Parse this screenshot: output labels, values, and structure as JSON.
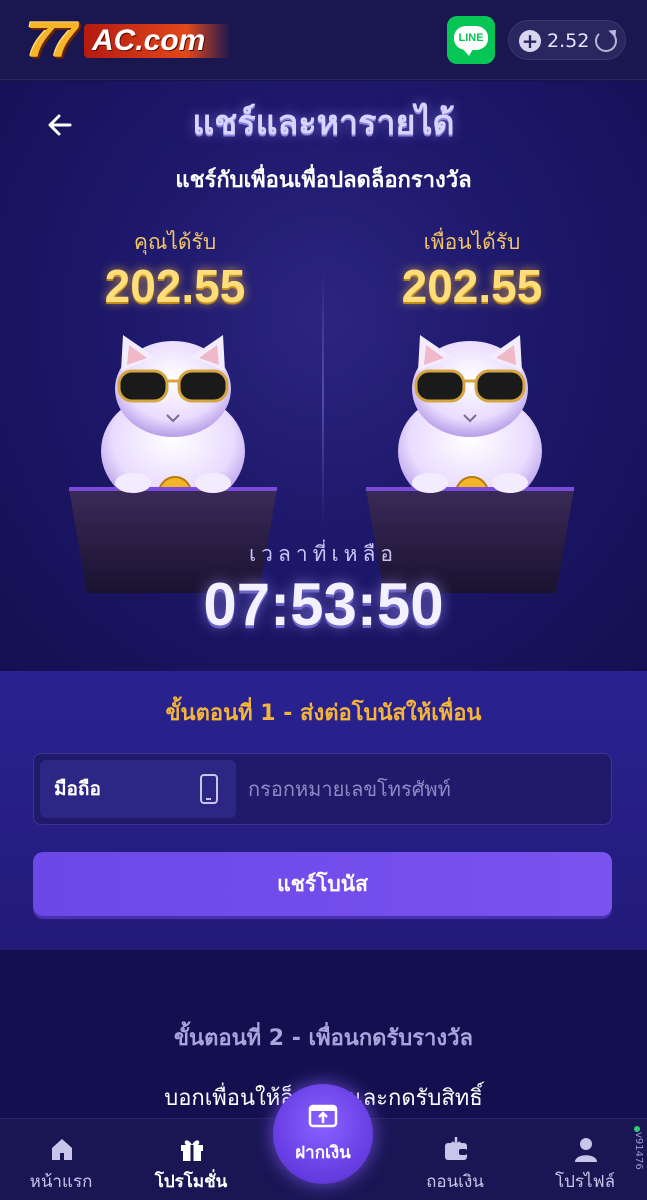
{
  "header": {
    "logo_number": "77",
    "logo_text": "AC.com",
    "line_label": "LINE",
    "balance": "2.52"
  },
  "hero": {
    "title": "แชร์และหารายได้",
    "subtitle": "แชร์กับเพื่อนเพื่อปลดล็อกรางวัล",
    "you_receive_label": "คุณได้รับ",
    "you_receive_value": "202.55",
    "friend_receive_label": "เพื่อนได้รับ",
    "friend_receive_value": "202.55",
    "time_left_label": "เวลาที่เหลือ",
    "time_left_value": "07:53:50"
  },
  "step1": {
    "title": "ขั้นตอนที่ 1 - ส่งต่อโบนัสให้เพื่อน",
    "phone_prefix_label": "มือถือ",
    "phone_placeholder": "กรอกหมายเลขโทรศัพท์",
    "share_button_label": "แชร์โบนัส"
  },
  "step2": {
    "title": "ขั้นตอนที่ 2 - เพื่อนกดรับรางวัล",
    "description": "บอกเพื่อนให้ล็อกอินและกดรับสิทธิ์"
  },
  "bottom_nav": {
    "home": "หน้าแรก",
    "promotion": "โปรโมชั่น",
    "deposit": "ฝากเงิน",
    "withdraw": "ถอนเงิน",
    "profile": "โปรไฟล์"
  },
  "version": "v91476"
}
